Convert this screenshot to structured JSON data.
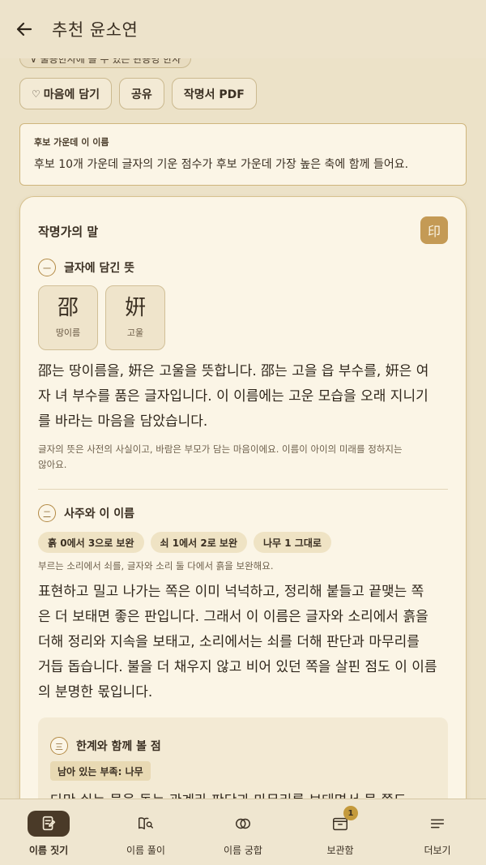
{
  "header": {
    "title": "추천 윤소연"
  },
  "top_cut_chip": {
    "label": "∨ 불용한자에 볼 수 있는 관용명 한자"
  },
  "actions": {
    "like_label": "마음에 담기",
    "share_label": "공유",
    "certificate_label": "작명서 PDF"
  },
  "info_box": {
    "label": "후보 가운데 이 이름",
    "text": "후보 10개 가운데 글자의 기운 점수가 후보 가운데 가장 높은 축에 함께 들어요."
  },
  "card": {
    "title": "작명가의 말",
    "seal": "印",
    "section1": {
      "num": "一",
      "title": "글자에 담긴 뜻",
      "hanja": [
        {
          "char": "邵",
          "meaning": "땅이름"
        },
        {
          "char": "姸",
          "meaning": "고울"
        }
      ],
      "body_lines": [
        "邵는 땅이름을, 姸은 고울을 뜻합니다. 邵는 고을 읍 부수를, 姸은 여",
        "자 녀 부수를 품은 글자입니다. 이 이름에는 고운 모습을 오래 지니기",
        "를 바라는 마음을 담았습니다."
      ],
      "note_lines": [
        "글자의 뜻은 사전의 사실이고, 바람은 부모가 담는 마음이에요. 이름이 아이의 미래를 정하지는",
        "않아요."
      ]
    },
    "section2": {
      "num": "二",
      "title": "사주와 이 이름",
      "tags": [
        "흙 0에서 3으로 보완",
        "쇠 1에서 2로 보완",
        "나무 1 그대로"
      ],
      "note": "부르는 소리에서 쇠를, 글자와 소리 둘 다에서 흙을 보완해요.",
      "body_lines": [
        "표현하고 밀고 나가는 쪽은 이미 넉넉하고, 정리해 붙들고 끝맺는 쪽",
        "은 더 보태면 좋은 판입니다. 그래서 이 이름은 글자와 소리에서 흙을",
        "더해 정리와 지속을 보태고, 소리에서는 쇠를 더해 판단과 마무리를",
        "거듭 돕습니다. 불을 더 채우지 않고 비어 있던 쪽을 살핀 점도 이 이름",
        "의 분명한 몫입니다."
      ]
    },
    "section3": {
      "num": "三",
      "title": "한계와 함께 볼 점",
      "tag": "남아 있는 부족: 나무",
      "text_partial": "다만 쉬는 물을 돕는 관계라 판단과 마무리를 보태면서 물 쪽도"
    }
  },
  "bottom_nav": {
    "items": [
      {
        "label": "이름 짓기",
        "icon": "pencil-note-icon",
        "active": true
      },
      {
        "label": "이름 풀이",
        "icon": "book-search-icon",
        "active": false
      },
      {
        "label": "이름 궁합",
        "icon": "rings-icon",
        "active": false
      },
      {
        "label": "보관함",
        "icon": "inbox-icon",
        "active": false,
        "badge": "1"
      },
      {
        "label": "더보기",
        "icon": "menu-icon",
        "active": false
      }
    ]
  },
  "colors": {
    "background": "#ece2c8",
    "card": "#fbf5e6",
    "accent": "#c49a55",
    "nav_active": "#4a3a28"
  }
}
